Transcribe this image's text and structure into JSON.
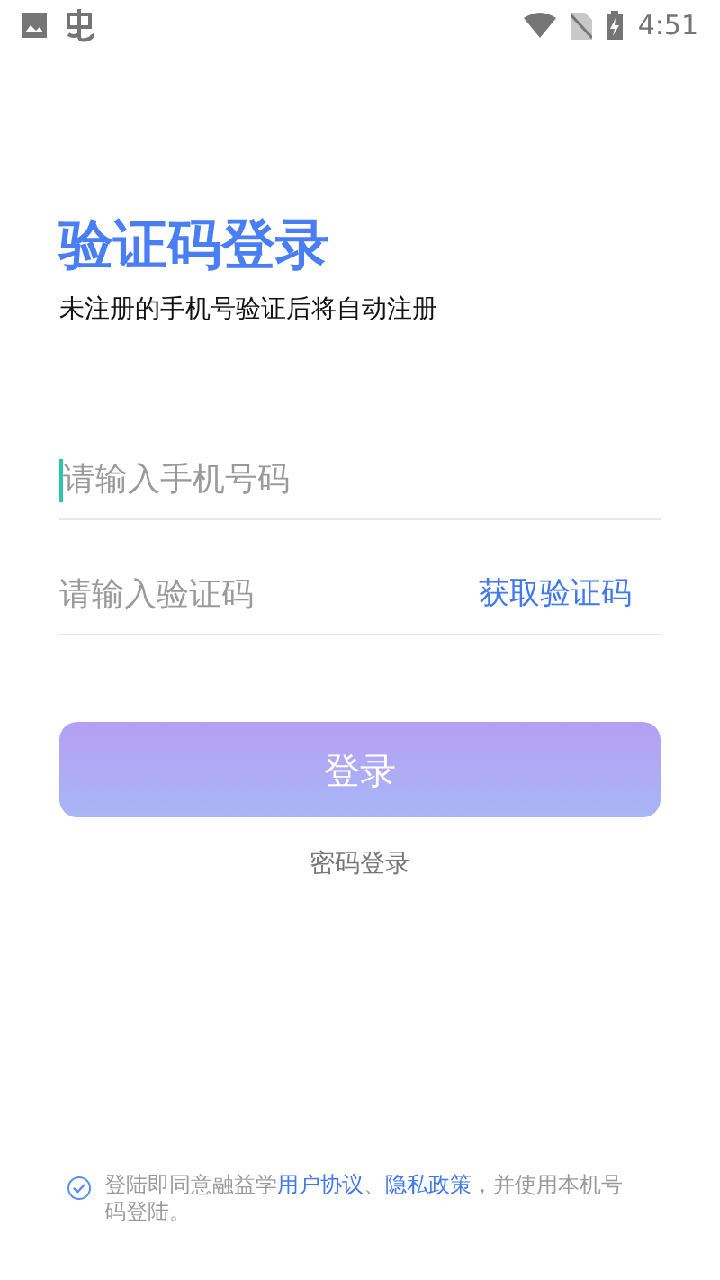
{
  "status_bar": {
    "time": "4:51"
  },
  "title": "验证码登录",
  "subtitle": "未注册的手机号验证后将自动注册",
  "phone_field": {
    "placeholder": "请输入手机号码"
  },
  "code_field": {
    "placeholder": "请输入验证码"
  },
  "get_code_button": "获取验证码",
  "login_button": "登录",
  "password_login_link": "密码登录",
  "agreement": {
    "checked": true,
    "text_before": "登陆即同意融益学",
    "user_agreement_link": "用户协议",
    "separator": "、",
    "privacy_link": "隐私政策",
    "text_after": "，并使用本机号码登陆。"
  }
}
